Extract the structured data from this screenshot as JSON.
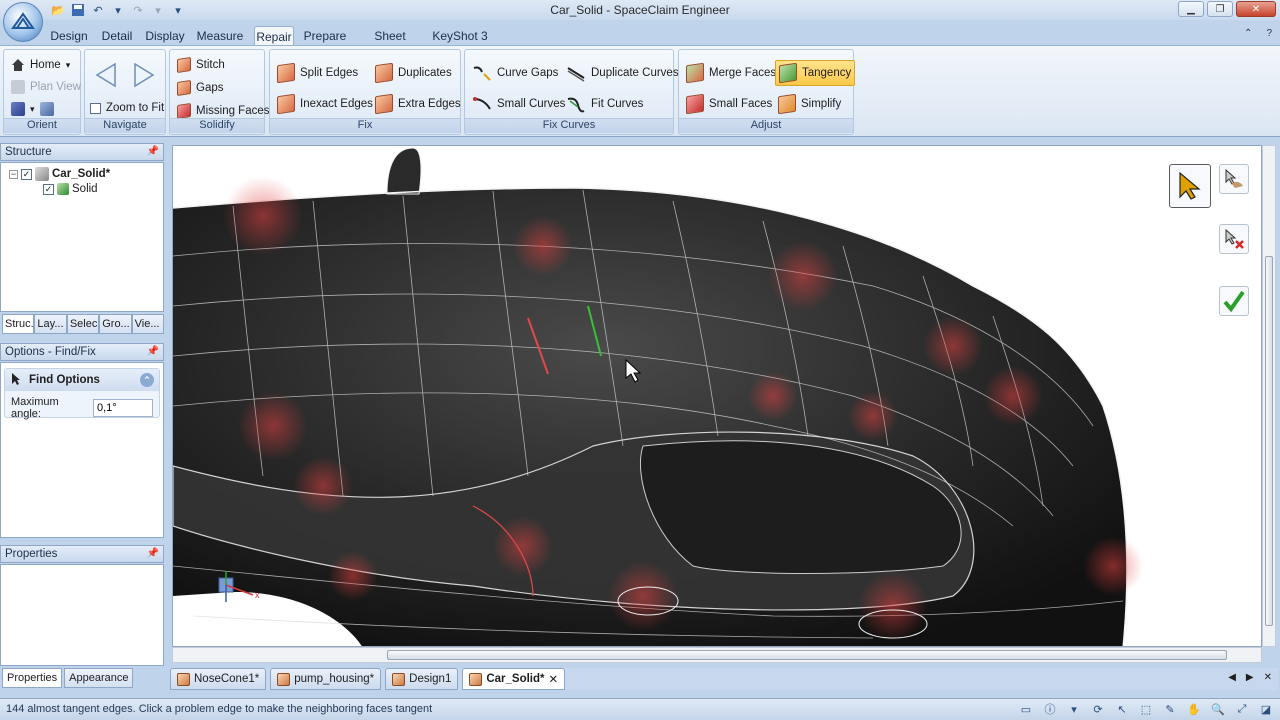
{
  "window": {
    "title": "Car_Solid - SpaceClaim Engineer"
  },
  "tabs": [
    "Design",
    "Detail",
    "Display",
    "Measure",
    "Repair",
    "Prepare",
    "Sheet Metal",
    "KeyShot 3"
  ],
  "active_tab": "Repair",
  "ribbon": {
    "orient": {
      "label": "Orient",
      "home": "Home",
      "plan_view": "Plan View"
    },
    "navigate": {
      "label": "Navigate",
      "zoom_to_fit": "Zoom to Fit"
    },
    "solidify": {
      "label": "Solidify",
      "stitch": "Stitch",
      "gaps": "Gaps",
      "missing_faces": "Missing Faces"
    },
    "fix": {
      "label": "Fix",
      "split_edges": "Split Edges",
      "duplicates": "Duplicates",
      "inexact_edges": "Inexact Edges",
      "extra_edges": "Extra Edges"
    },
    "fix_curves": {
      "label": "Fix Curves",
      "curve_gaps": "Curve Gaps",
      "duplicate_curves": "Duplicate Curves",
      "small_curves": "Small Curves",
      "fit_curves": "Fit Curves"
    },
    "adjust": {
      "label": "Adjust",
      "merge_faces": "Merge Faces",
      "tangency": "Tangency",
      "small_faces": "Small Faces",
      "simplify": "Simplify"
    }
  },
  "structure": {
    "title": "Structure",
    "root": "Car_Solid*",
    "child": "Solid",
    "tabs": [
      "Struc...",
      "Lay...",
      "Selec...",
      "Gro...",
      "Vie..."
    ]
  },
  "options": {
    "title": "Options - Find/Fix",
    "find_options": "Find Options",
    "max_angle_label": "Maximum angle:",
    "max_angle_value": "0,1°"
  },
  "properties": {
    "title": "Properties",
    "tabs": [
      "Properties",
      "Appearance"
    ]
  },
  "doc_tabs": [
    "NoseCone1*",
    "pump_housing*",
    "Design1",
    "Car_Solid*"
  ],
  "active_doc": "Car_Solid*",
  "status": {
    "message": "144 almost tangent edges. Click a problem edge to make the neighboring faces tangent"
  },
  "colors": {
    "accent": "#ffc84a",
    "ribbon_bg": "#dbe6f3",
    "model_dark": "#2a2a2a",
    "problem_highlight": "#d23b3b"
  }
}
